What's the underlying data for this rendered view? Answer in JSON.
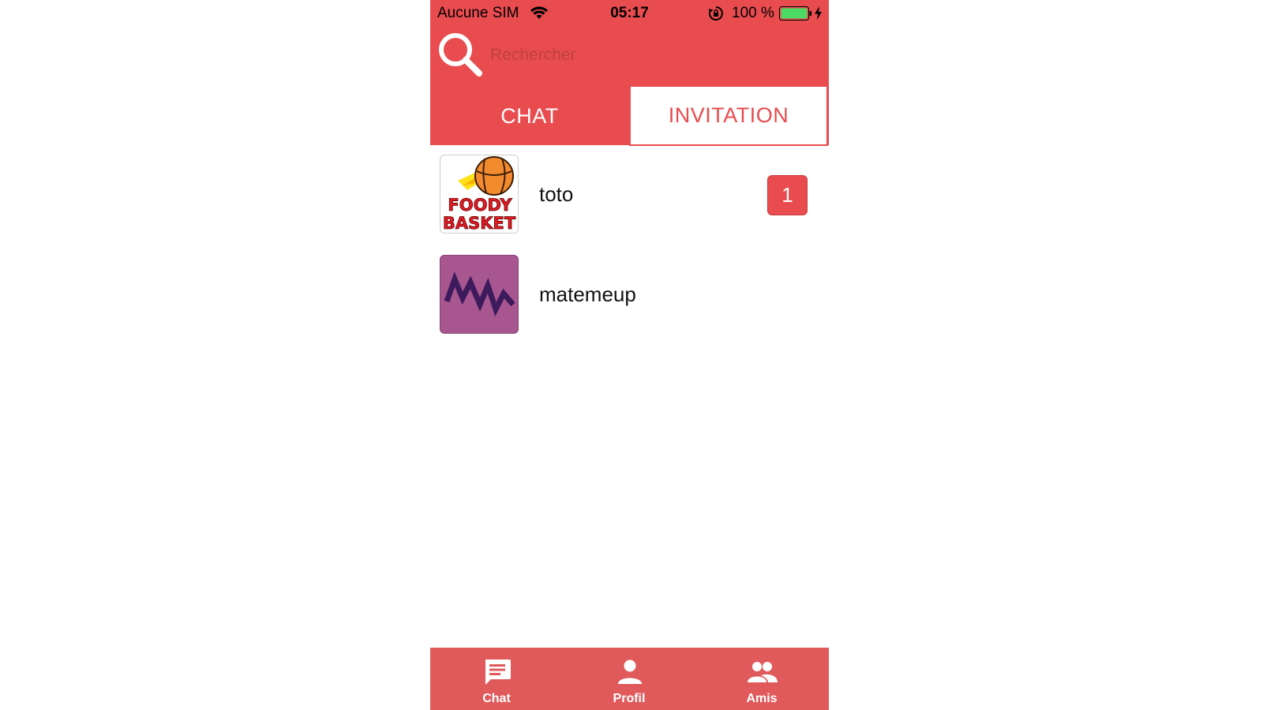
{
  "status_bar": {
    "carrier": "Aucune SIM",
    "time": "05:17",
    "battery": "100 %",
    "icons": [
      "wifi-icon",
      "rotation-lock-icon",
      "battery-icon",
      "charging-icon"
    ]
  },
  "search": {
    "placeholder": "Rechercher",
    "value": "",
    "icon": "search-icon"
  },
  "tabs": [
    {
      "label": "CHAT",
      "active": false
    },
    {
      "label": "INVITATION",
      "active": true
    }
  ],
  "list": [
    {
      "name": "toto",
      "avatar": "foody-basket-logo",
      "badge": "1",
      "logo_text": [
        "FOODY",
        "BASKET"
      ]
    },
    {
      "name": "matemeup",
      "avatar": "matemeup-logo"
    }
  ],
  "bottom_nav": [
    {
      "label": "Chat",
      "icon": "chat-icon"
    },
    {
      "label": "Profil",
      "icon": "person-icon"
    },
    {
      "label": "Amis",
      "icon": "people-icon"
    }
  ],
  "colors": {
    "primary": "#e84c4f",
    "nav_background": "#e05a5c",
    "battery_green": "#4cd964",
    "matemeup_purple": "#a8568f"
  }
}
